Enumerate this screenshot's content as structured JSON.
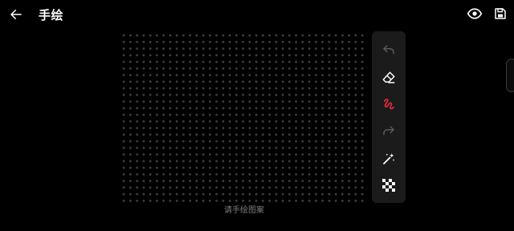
{
  "header": {
    "title": "手绘",
    "back_icon": "arrow-left-icon",
    "preview_icon": "eye-icon",
    "save_icon": "save-icon"
  },
  "canvas": {
    "hint": "请手绘图案",
    "dot_color": "#3e3e3e"
  },
  "tools": [
    {
      "name": "undo",
      "icon": "undo-icon",
      "enabled": false
    },
    {
      "name": "eraser",
      "icon": "eraser-icon",
      "enabled": true
    },
    {
      "name": "brush",
      "icon": "brush-icon",
      "active": true
    },
    {
      "name": "redo",
      "icon": "redo-icon",
      "enabled": false
    },
    {
      "name": "magic",
      "icon": "magic-wand-icon",
      "enabled": true
    },
    {
      "name": "mosaic",
      "icon": "mosaic-icon",
      "enabled": true
    }
  ],
  "colors": {
    "background": "#000000",
    "panel": "#1b1b1b",
    "accent": "#e8283c",
    "disabled": "#5a5a5a",
    "hint": "#7d7d7d"
  }
}
